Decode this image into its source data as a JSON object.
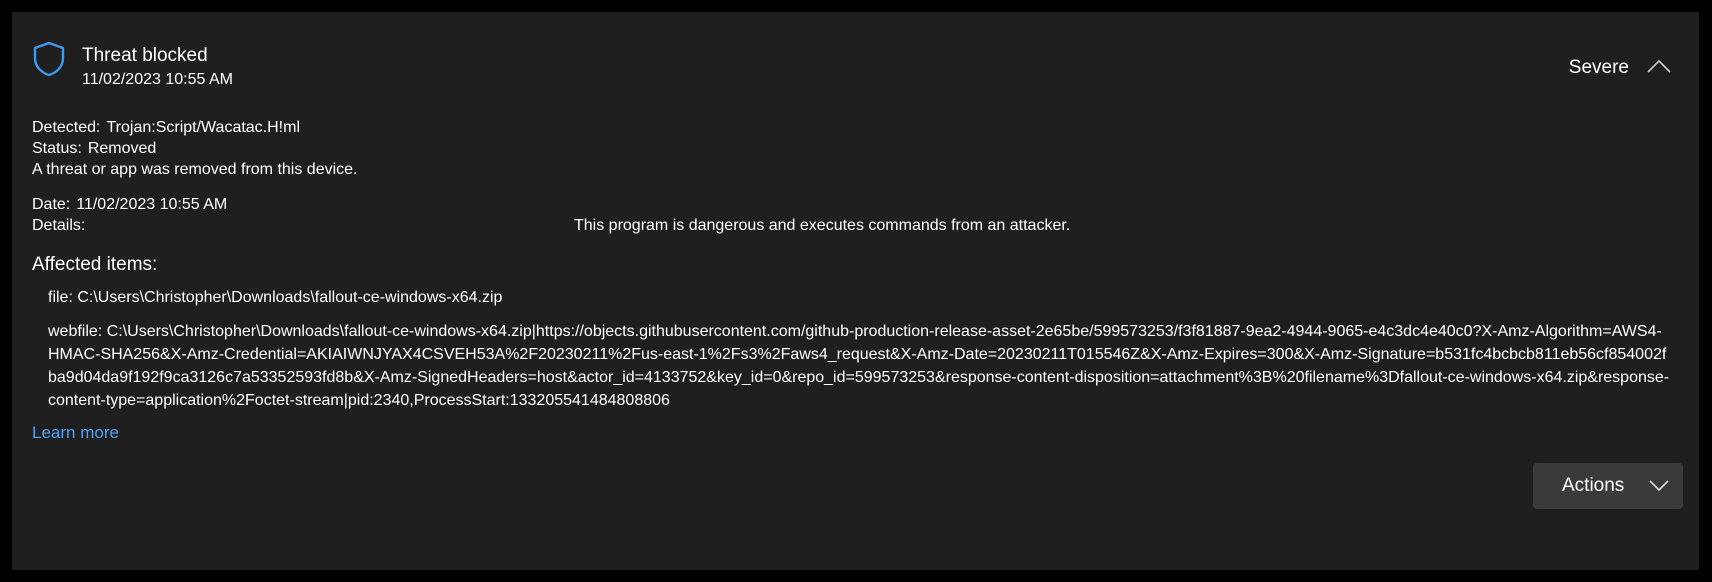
{
  "card": {
    "title": "Threat blocked",
    "timestamp": "11/02/2023 10:55 AM",
    "severity": "Severe",
    "icon": "shield-icon",
    "accent_color": "#3a9bf0"
  },
  "detected": {
    "label": "Detected:",
    "value": "Trojan:Script/Wacatac.H!ml"
  },
  "status": {
    "label": "Status:",
    "value": "Removed"
  },
  "message": "A threat or app was removed from this device.",
  "date": {
    "label": "Date:",
    "value": "11/02/2023 10:55 AM"
  },
  "details": {
    "label": "Details:",
    "value": "This program is dangerous and executes commands from an attacker."
  },
  "affected": {
    "heading": "Affected items:",
    "items": [
      "file: C:\\Users\\Christopher\\Downloads\\fallout-ce-windows-x64.zip",
      "webfile: C:\\Users\\Christopher\\Downloads\\fallout-ce-windows-x64.zip|https://objects.githubusercontent.com/github-production-release-asset-2e65be/599573253/f3f81887-9ea2-4944-9065-e4c3dc4e40c0?X-Amz-Algorithm=AWS4-HMAC-SHA256&X-Amz-Credential=AKIAIWNJYAX4CSVEH53A%2F20230211%2Fus-east-1%2Fs3%2Faws4_request&X-Amz-Date=20230211T015546Z&X-Amz-Expires=300&X-Amz-Signature=b531fc4bcbcb811eb56cf854002fba9d04da9f192f9ca3126c7a53352593fd8b&X-Amz-SignedHeaders=host&actor_id=4133752&key_id=0&repo_id=599573253&response-content-disposition=attachment%3B%20filename%3Dfallout-ce-windows-x64.zip&response-content-type=application%2Foctet-stream|pid:2340,ProcessStart:133205541484808806"
    ]
  },
  "learn_more": "Learn more",
  "actions": {
    "label": "Actions"
  }
}
